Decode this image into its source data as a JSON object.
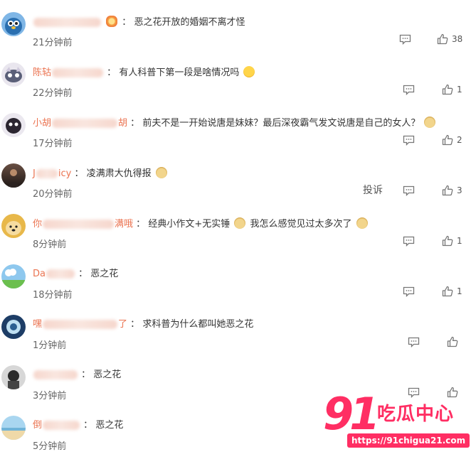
{
  "icons": {
    "reply": "reply-icon",
    "like": "thumbs-up-icon"
  },
  "colors": {
    "username": "#eb7350",
    "brand": "#ff2e63"
  },
  "report_label": "投诉",
  "comments": [
    {
      "user_prefix": "",
      "user_suffix": "",
      "emoji_after_name": "flower",
      "text": "恶之花开放的婚姻不离才怪",
      "time": "21分钟前",
      "likes": "38"
    },
    {
      "user_prefix": "陈轱",
      "user_suffix": "",
      "text": "有人科普下第一段是啥情况吗",
      "time": "22分钟前",
      "likes": "1"
    },
    {
      "user_prefix": "小胡",
      "user_suffix": "胡",
      "text": "前夫不是一开始说唐是妹妹？最后深夜霸气发文说唐是自己的女人？",
      "time": "17分钟前",
      "likes": "2"
    },
    {
      "user_prefix": "J",
      "user_suffix": "icy",
      "text": "凌满肃大仇得报",
      "time": "20分钟前",
      "likes": "3"
    },
    {
      "user_prefix": "你",
      "user_suffix": "满哦",
      "text": "经典小作文+无实锤",
      "text2": "我怎么感觉见过太多次了",
      "time": "8分钟前",
      "likes": "1"
    },
    {
      "user_prefix": "Da",
      "user_suffix": "",
      "text": "恶之花",
      "time": "18分钟前",
      "likes": "1"
    },
    {
      "user_prefix": "嘿",
      "user_suffix": "了",
      "text": "求科普为什么都叫她恶之花",
      "time": "1分钟前",
      "likes": ""
    },
    {
      "user_prefix": "",
      "user_suffix": "",
      "text": "恶之花",
      "time": "3分钟前",
      "likes": ""
    },
    {
      "user_prefix": "倒",
      "user_suffix": "",
      "text": "恶之花",
      "time": "5分钟前",
      "likes": ""
    }
  ],
  "watermark": {
    "number": "91",
    "title": "吃瓜中心",
    "url": "https://91chigua21.com"
  }
}
